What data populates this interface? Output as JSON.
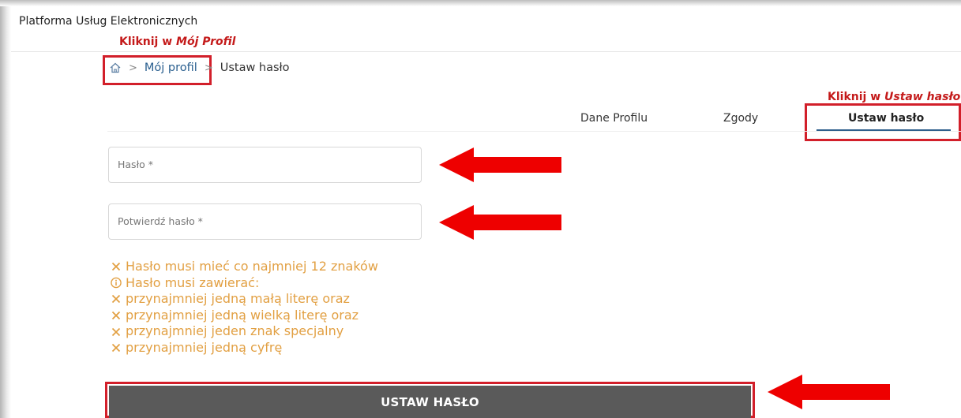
{
  "app": {
    "title": "Platforma Usług Elektronicznych"
  },
  "annotations": {
    "profile_prefix": "Kliknij w ",
    "profile_target": "Mój Profil",
    "tab_prefix": "Kliknij w ",
    "tab_target": "Ustaw hasło"
  },
  "breadcrumb": {
    "home_icon": "home-icon",
    "separator": ">",
    "items": [
      "Mój profil",
      "Ustaw hasło"
    ]
  },
  "tabs": [
    {
      "label": "Dane Profilu",
      "active": false
    },
    {
      "label": "Zgody",
      "active": false
    },
    {
      "label": "Ustaw hasło",
      "active": true
    }
  ],
  "form": {
    "password": {
      "placeholder": "Hasło *",
      "value": ""
    },
    "confirm": {
      "placeholder": "Potwierdź hasło *",
      "value": ""
    }
  },
  "rules": [
    {
      "icon": "x-icon",
      "text": "Hasło musi mieć co najmniej 12 znaków"
    },
    {
      "icon": "info-icon",
      "text": "Hasło musi zawierać:"
    },
    {
      "icon": "x-icon",
      "text": "przynajmniej jedną małą literę oraz"
    },
    {
      "icon": "x-icon",
      "text": "przynajmniej jedną wielką literę oraz"
    },
    {
      "icon": "x-icon",
      "text": "przynajmniej jeden znak specjalny"
    },
    {
      "icon": "x-icon",
      "text": "przynajmniej jedną cyfrę"
    }
  ],
  "submit": {
    "label": "USTAW HASŁO"
  },
  "colors": {
    "annotation_red": "#d21f2a",
    "rule_orange": "#e2a043",
    "link_blue": "#2a5f8f",
    "button_gray": "#5a5a5a"
  }
}
